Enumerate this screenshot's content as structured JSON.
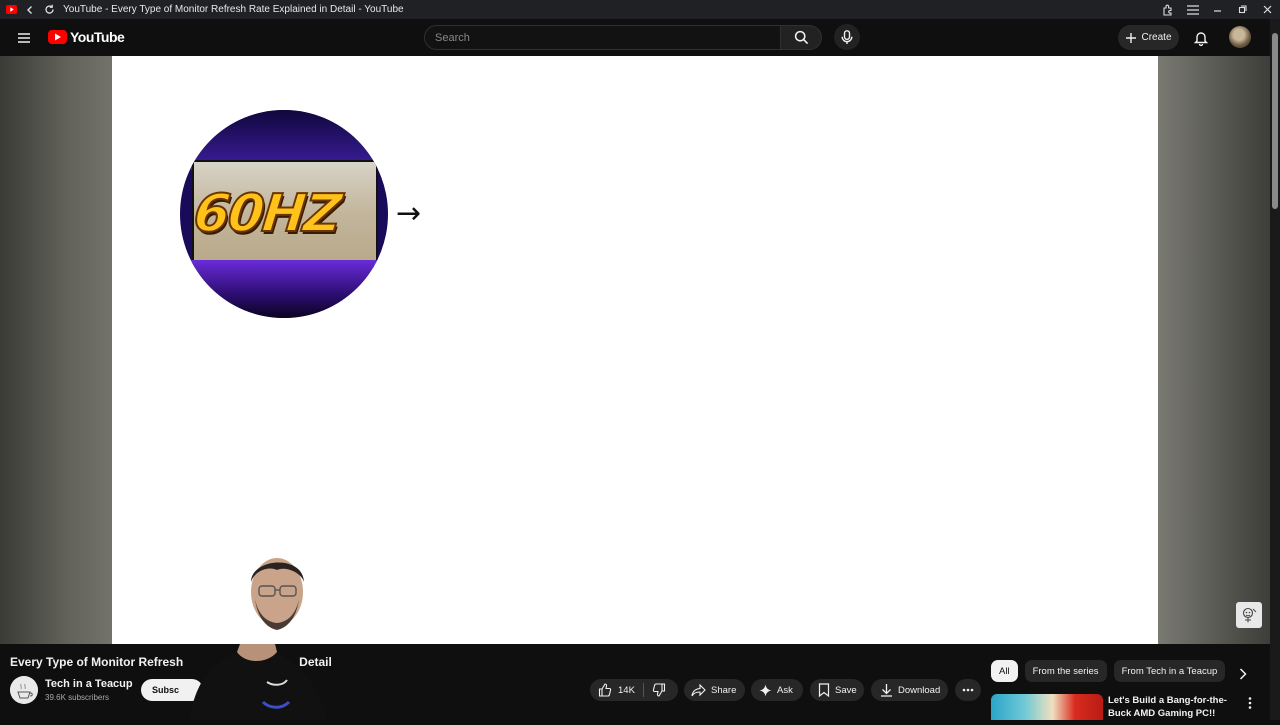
{
  "browser": {
    "window_title": "YouTube - Every Type of Monitor Refresh Rate Explained in Detail - YouTube"
  },
  "masthead": {
    "logo_text": "YouTube",
    "search_placeholder": "Search",
    "create_label": "Create"
  },
  "player": {
    "thumbnail_text": "60HZ",
    "arrow_glyph": "→"
  },
  "video": {
    "title_visible_left": "Every Type of Monitor Refresh",
    "title_visible_right": "Detail",
    "channel_name": "Tech in a Teacup",
    "subscribers": "39.6K subscribers",
    "subscribe_label": "Subsc"
  },
  "actions": {
    "like_count": "14K",
    "share_label": "Share",
    "ask_label": "Ask",
    "save_label": "Save",
    "download_label": "Download"
  },
  "chips": [
    "All",
    "From the series",
    "From Tech in a Teacup"
  ],
  "recommendation": {
    "title": "Let's Build a Bang-for-the-Buck AMD Gaming PC!!"
  },
  "colors": {
    "brand_red": "#ff0000",
    "page_bg": "#0f0f0f",
    "pill_bg": "#272727"
  }
}
